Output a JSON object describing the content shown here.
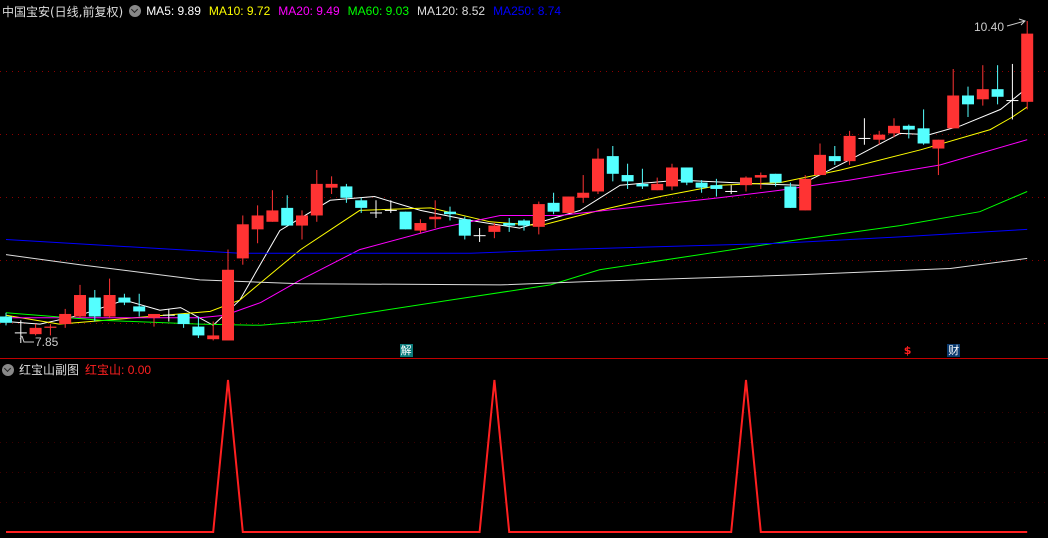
{
  "header": {
    "title": "中国宝安(日线,前复权)",
    "ma": [
      {
        "label": "MA5: 9.89",
        "color": "#ffffff"
      },
      {
        "label": "MA10: 9.72",
        "color": "#ffff00"
      },
      {
        "label": "MA20: 9.49",
        "color": "#ff00ff"
      },
      {
        "label": "MA60: 9.03",
        "color": "#00ff00"
      },
      {
        "label": "MA120: 8.52",
        "color": "#dddddd"
      },
      {
        "label": "MA250: 8.74",
        "color": "#0000ff"
      }
    ]
  },
  "annotations": {
    "high_label": "10.40",
    "low_label": "7.85"
  },
  "markers": [
    {
      "text": "解",
      "index": 27,
      "type": "info"
    },
    {
      "text": "$",
      "index": 61,
      "type": "dollar"
    },
    {
      "text": "财",
      "index": 64,
      "type": "finance"
    }
  ],
  "colors": {
    "up": "#ff3333",
    "down": "#54ffff",
    "grid": "#8b0000",
    "sub_line": "#ff2020"
  },
  "sub": {
    "title": "红宝山副图",
    "indicator_name": "红宝山",
    "indicator_value": ": 0.00"
  },
  "chart_data": {
    "type": "candlestick",
    "ylim": [
      7.85,
      10.4
    ],
    "candles": [
      [
        8.06,
        8.01,
        8.09,
        7.99
      ],
      [
        7.93,
        7.93,
        8.03,
        7.85
      ],
      [
        7.92,
        7.97,
        8.0,
        7.91
      ],
      [
        7.97,
        7.98,
        8.0,
        7.91
      ],
      [
        8.0,
        8.08,
        8.12,
        7.97
      ],
      [
        8.06,
        8.23,
        8.31,
        8.05
      ],
      [
        8.21,
        8.06,
        8.27,
        8.02
      ],
      [
        8.06,
        8.23,
        8.36,
        8.05
      ],
      [
        8.21,
        8.17,
        8.24,
        8.15
      ],
      [
        8.14,
        8.1,
        8.24,
        8.06
      ],
      [
        8.05,
        8.08,
        8.08,
        7.98
      ],
      [
        8.07,
        8.07,
        8.12,
        8.02
      ],
      [
        8.08,
        8.0,
        8.08,
        7.97
      ],
      [
        7.98,
        7.91,
        8.06,
        7.89
      ],
      [
        7.88,
        7.91,
        8.02,
        7.87
      ],
      [
        7.87,
        8.43,
        8.59,
        7.87
      ],
      [
        8.52,
        8.79,
        8.86,
        8.47
      ],
      [
        8.75,
        8.86,
        8.94,
        8.64
      ],
      [
        8.81,
        8.9,
        9.06,
        8.81
      ],
      [
        8.92,
        8.78,
        9.02,
        8.78
      ],
      [
        8.78,
        8.86,
        8.9,
        8.67
      ],
      [
        8.86,
        9.11,
        9.22,
        8.81
      ],
      [
        9.08,
        9.11,
        9.17,
        9.03
      ],
      [
        9.09,
        9.0,
        9.11,
        8.96
      ],
      [
        8.98,
        8.92,
        9.0,
        8.88
      ],
      [
        8.88,
        8.88,
        8.98,
        8.84
      ],
      [
        8.9,
        8.9,
        8.98,
        8.88
      ],
      [
        8.89,
        8.75,
        8.89,
        8.75
      ],
      [
        8.74,
        8.8,
        8.83,
        8.72
      ],
      [
        8.83,
        8.85,
        8.98,
        8.76
      ],
      [
        8.89,
        8.87,
        8.93,
        8.82
      ],
      [
        8.83,
        8.7,
        8.85,
        8.67
      ],
      [
        8.7,
        8.7,
        8.76,
        8.65
      ],
      [
        8.73,
        8.78,
        8.8,
        8.68
      ],
      [
        8.8,
        8.78,
        8.84,
        8.73
      ],
      [
        8.82,
        8.78,
        8.83,
        8.74
      ],
      [
        8.77,
        8.95,
        8.97,
        8.71
      ],
      [
        8.96,
        8.89,
        9.04,
        8.87
      ],
      [
        8.88,
        9.01,
        9.01,
        8.88
      ],
      [
        9.0,
        9.04,
        9.18,
        8.96
      ],
      [
        9.05,
        9.31,
        9.39,
        9.03
      ],
      [
        9.33,
        9.19,
        9.41,
        9.13
      ],
      [
        9.18,
        9.13,
        9.27,
        9.07
      ],
      [
        9.11,
        9.09,
        9.23,
        9.07
      ],
      [
        9.06,
        9.11,
        9.16,
        9.06
      ],
      [
        9.09,
        9.24,
        9.27,
        9.06
      ],
      [
        9.24,
        9.12,
        9.24,
        9.1
      ],
      [
        9.12,
        9.08,
        9.14,
        9.04
      ],
      [
        9.1,
        9.07,
        9.15,
        9.01
      ],
      [
        9.05,
        9.05,
        9.1,
        9.03
      ],
      [
        9.1,
        9.16,
        9.17,
        9.05
      ],
      [
        9.16,
        9.18,
        9.2,
        9.07
      ],
      [
        9.19,
        9.12,
        9.19,
        9.09
      ],
      [
        9.09,
        8.92,
        9.12,
        8.92
      ],
      [
        8.9,
        9.15,
        9.18,
        8.9
      ],
      [
        9.18,
        9.34,
        9.43,
        9.18
      ],
      [
        9.33,
        9.29,
        9.41,
        9.26
      ],
      [
        9.29,
        9.49,
        9.53,
        9.26
      ],
      [
        9.47,
        9.47,
        9.63,
        9.42
      ],
      [
        9.46,
        9.5,
        9.53,
        9.42
      ],
      [
        9.51,
        9.57,
        9.63,
        9.48
      ],
      [
        9.57,
        9.54,
        9.58,
        9.47
      ],
      [
        9.55,
        9.43,
        9.7,
        9.42
      ],
      [
        9.39,
        9.46,
        9.46,
        9.18
      ],
      [
        9.55,
        9.81,
        10.02,
        9.55
      ],
      [
        9.81,
        9.74,
        9.88,
        9.64
      ],
      [
        9.78,
        9.86,
        10.05,
        9.73
      ],
      [
        9.86,
        9.8,
        10.05,
        9.74
      ],
      [
        9.77,
        9.77,
        10.06,
        9.62
      ],
      [
        9.76,
        10.3,
        10.4,
        9.7
      ]
    ],
    "ma_lines": [
      {
        "name": "MA5",
        "color": "#ffffff",
        "points": [
          [
            0,
            8.02
          ],
          [
            2.3,
            8.0
          ],
          [
            5,
            8.07
          ],
          [
            8,
            8.19
          ],
          [
            10.4,
            8.11
          ],
          [
            11.8,
            8.13
          ],
          [
            14,
            7.99
          ],
          [
            15.8,
            8.19
          ],
          [
            18.5,
            8.74
          ],
          [
            21.9,
            8.98
          ],
          [
            24.9,
            9.01
          ],
          [
            28,
            8.9
          ],
          [
            31.4,
            8.82
          ],
          [
            34.7,
            8.76
          ],
          [
            38.8,
            8.9
          ],
          [
            41.5,
            9.1
          ],
          [
            45.5,
            9.14
          ],
          [
            50.9,
            9.11
          ],
          [
            53.6,
            9.1
          ],
          [
            57,
            9.3
          ],
          [
            60.4,
            9.51
          ],
          [
            62.4,
            9.5
          ],
          [
            64.5,
            9.57
          ],
          [
            67.2,
            9.7
          ],
          [
            69,
            9.87
          ]
        ]
      },
      {
        "name": "MA10",
        "color": "#ffff00",
        "points": [
          [
            0,
            8.07
          ],
          [
            3.6,
            8.0
          ],
          [
            9.7,
            8.06
          ],
          [
            13.8,
            8.1
          ],
          [
            15.8,
            8.19
          ],
          [
            19.9,
            8.59
          ],
          [
            23.9,
            8.9
          ],
          [
            28.7,
            8.92
          ],
          [
            32.7,
            8.81
          ],
          [
            36.1,
            8.78
          ],
          [
            40.1,
            8.9
          ],
          [
            44.2,
            9.01
          ],
          [
            48.2,
            9.1
          ],
          [
            52.3,
            9.12
          ],
          [
            56.4,
            9.22
          ],
          [
            61.8,
            9.38
          ],
          [
            66.5,
            9.54
          ],
          [
            68,
            9.64
          ],
          [
            69,
            9.72
          ]
        ]
      },
      {
        "name": "MA20",
        "color": "#ff00ff",
        "points": [
          [
            0,
            8.05
          ],
          [
            13.1,
            8.05
          ],
          [
            14.8,
            8.07
          ],
          [
            17.2,
            8.17
          ],
          [
            19.9,
            8.35
          ],
          [
            23.9,
            8.59
          ],
          [
            29.3,
            8.76
          ],
          [
            33.4,
            8.86
          ],
          [
            37.4,
            8.86
          ],
          [
            42.8,
            8.93
          ],
          [
            48.2,
            9.0
          ],
          [
            52.3,
            9.06
          ],
          [
            57,
            9.14
          ],
          [
            63.1,
            9.26
          ],
          [
            69,
            9.46
          ]
        ]
      },
      {
        "name": "MA60",
        "color": "#00ff00",
        "points": [
          [
            0,
            8.09
          ],
          [
            6.4,
            8.03
          ],
          [
            13.1,
            8.0
          ],
          [
            17.2,
            7.99
          ],
          [
            21.2,
            8.03
          ],
          [
            30,
            8.19
          ],
          [
            36.8,
            8.31
          ],
          [
            40.1,
            8.43
          ],
          [
            46.9,
            8.55
          ],
          [
            53.6,
            8.67
          ],
          [
            60.4,
            8.78
          ],
          [
            65.8,
            8.89
          ],
          [
            69,
            9.05
          ]
        ]
      },
      {
        "name": "MA120",
        "color": "#dddddd",
        "points": [
          [
            0,
            8.55
          ],
          [
            5,
            8.47
          ],
          [
            13.1,
            8.35
          ],
          [
            19.9,
            8.32
          ],
          [
            33.4,
            8.31
          ],
          [
            40.1,
            8.34
          ],
          [
            53.6,
            8.39
          ],
          [
            63.8,
            8.44
          ],
          [
            69,
            8.52
          ]
        ]
      },
      {
        "name": "MA250",
        "color": "#0000ff",
        "points": [
          [
            0,
            8.67
          ],
          [
            15.8,
            8.56
          ],
          [
            31.4,
            8.56
          ],
          [
            37.4,
            8.59
          ],
          [
            52.3,
            8.64
          ],
          [
            60.4,
            8.69
          ],
          [
            69,
            8.75
          ]
        ]
      }
    ],
    "sub_series": {
      "name": "红宝山",
      "ylim": [
        0,
        1
      ],
      "spikes_at": [
        15,
        33,
        50
      ]
    }
  }
}
